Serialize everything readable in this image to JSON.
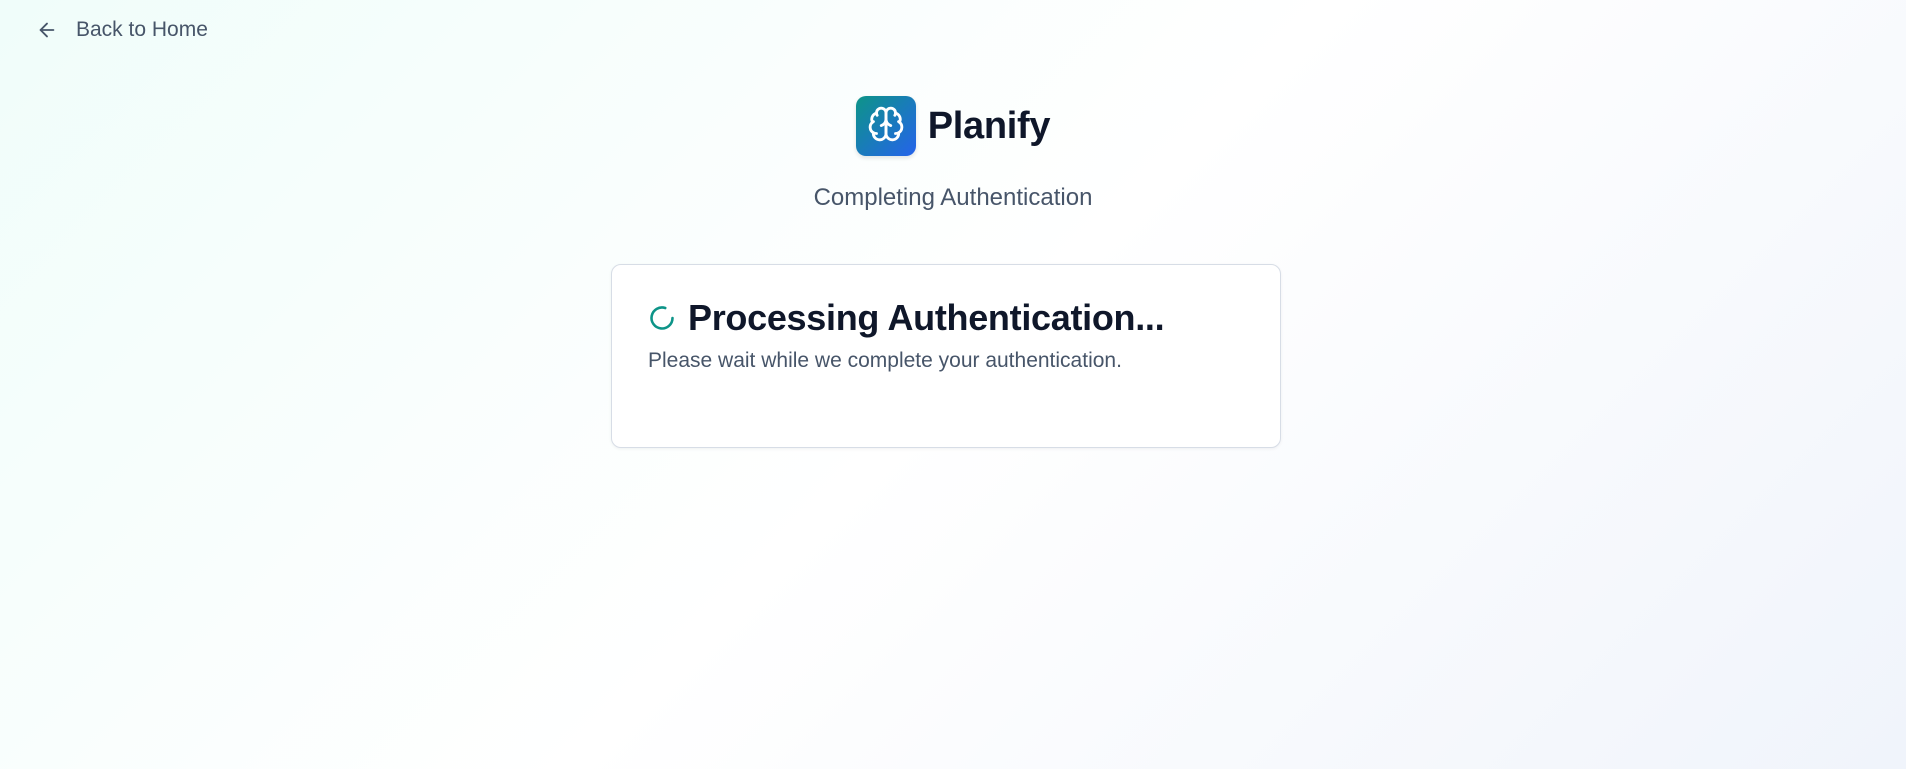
{
  "nav": {
    "back_label": "Back to Home",
    "back_icon": "arrow-left-icon"
  },
  "brand": {
    "name": "Planify",
    "logo_icon": "brain-icon"
  },
  "page": {
    "subtitle": "Completing Authentication"
  },
  "card": {
    "title": "Processing Authentication...",
    "description": "Please wait while we complete your authentication.",
    "status_icon": "loading-spinner-icon"
  },
  "colors": {
    "accent": "#0d9488",
    "logo_gradient_start": "#0d9488",
    "logo_gradient_end": "#2563eb",
    "text_primary": "#0f172a",
    "text_muted": "#475569"
  }
}
